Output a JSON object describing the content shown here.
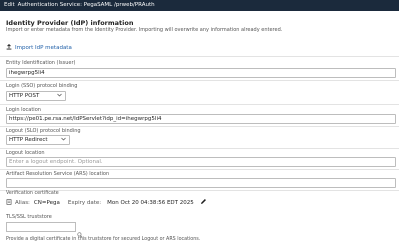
{
  "window": {
    "prefix": "Edit",
    "title": "Authentication Service: PegaSAML /prweb/PRAuth"
  },
  "section": {
    "title": "Identity Provider (IdP) information",
    "description": "Import or enter metadata from the Identity Provider. Importing will overwrite any information already entered."
  },
  "import_link": {
    "label": "Import IdP metadata",
    "icon": "upload-icon"
  },
  "fields": {
    "entity_id": {
      "label": "Entity Identification (Issuer)",
      "value": "ihegwrpg5li4"
    },
    "login_binding": {
      "label": "Login (SSO) protocol binding",
      "value": "HTTP POST"
    },
    "login_location": {
      "label": "Login location",
      "value": "https://pe01.pe.rsa.net/IdPServlet?idp_id=ihegwrpg5li4"
    },
    "logout_binding": {
      "label": "Logout (SLO) protocol binding",
      "value": "HTTP Redirect"
    },
    "logout_location": {
      "label": "Logout location",
      "placeholder": "Enter a logout endpoint. Optional."
    },
    "ars_location": {
      "label": "Artifact Resolution Service (ARS) location",
      "value": ""
    }
  },
  "verification": {
    "label": "Verification certificate",
    "alias_label": "Alias:",
    "alias_value": "CN=Pega",
    "expiry_label": "Expiry date:",
    "expiry_value": "Mon Oct 20 04:38:56 EDT 2025",
    "edit_icon": "pencil-icon"
  },
  "truststore": {
    "label": "TLS/SSL truststore",
    "note": "Provide a digital certificate in this truststore for secured Logout or ARS locations."
  },
  "colors": {
    "titlebar": "#1b2a3c",
    "link": "#1f5fa8",
    "label": "#555555"
  }
}
